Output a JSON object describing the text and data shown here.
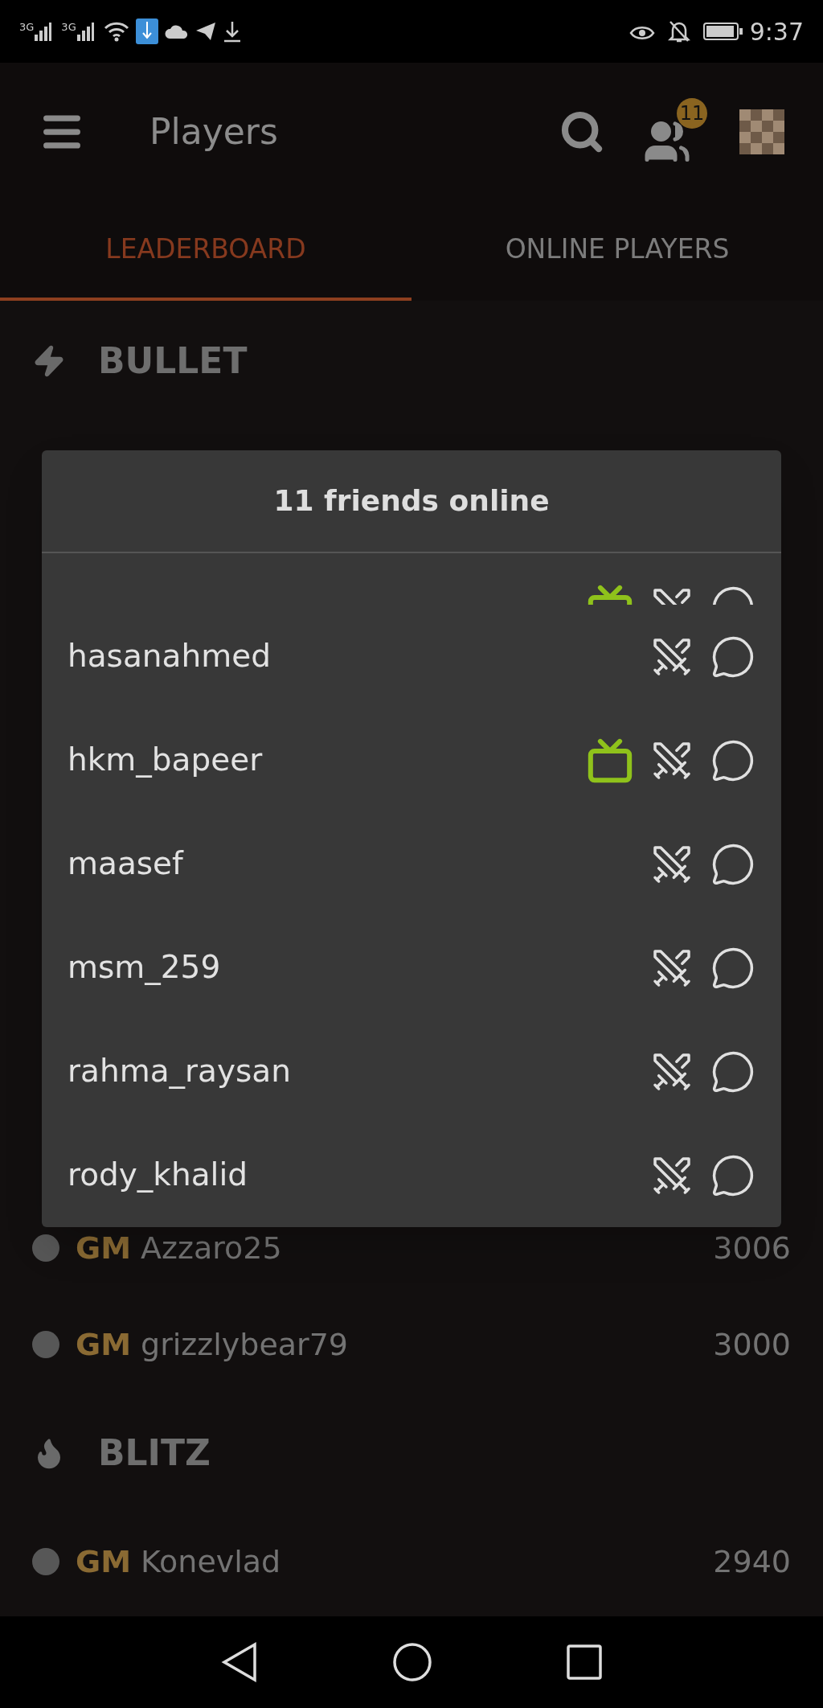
{
  "status_bar": {
    "signal_labels": [
      "3G",
      "3G"
    ],
    "time": "9:37"
  },
  "app_bar": {
    "title": "Players",
    "friends_badge": "11"
  },
  "tabs": [
    {
      "label": "LEADERBOARD",
      "selected": true
    },
    {
      "label": "ONLINE PLAYERS",
      "selected": false
    }
  ],
  "sections_top": [
    {
      "title": "BULLET",
      "kind": "bullet"
    }
  ],
  "sections_bottom": [
    {
      "kind": "rows",
      "rows": [
        {
          "title": "GM",
          "name": "Azzaro25",
          "rating": "3006"
        },
        {
          "title": "GM",
          "name": "grizzlybear79",
          "rating": "3000"
        }
      ]
    },
    {
      "kind": "blitz",
      "title": "BLITZ"
    },
    {
      "kind": "rows",
      "rows": [
        {
          "title": "GM",
          "name": "Konevlad",
          "rating": "2940"
        }
      ]
    }
  ],
  "dialog": {
    "title": "11 friends online",
    "friends": [
      {
        "watching": true
      },
      {
        "name": "hasanahmed",
        "watching": false
      },
      {
        "name": "hkm_bapeer",
        "watching": true
      },
      {
        "name": "maasef",
        "watching": false
      },
      {
        "name": "msm_259",
        "watching": false
      },
      {
        "name": "rahma_raysan",
        "watching": false
      },
      {
        "name": "rody_khalid",
        "watching": false
      }
    ]
  }
}
